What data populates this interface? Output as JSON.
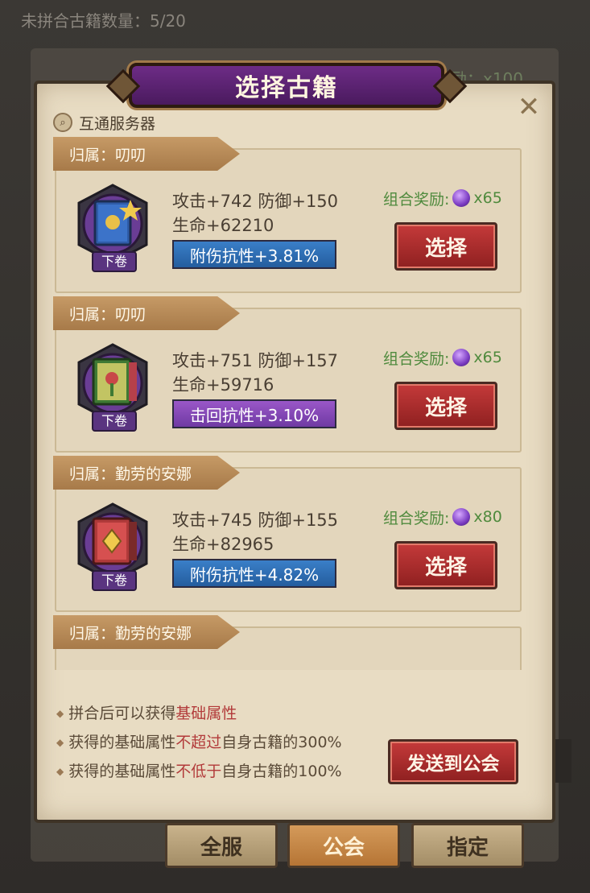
{
  "header": {
    "unassembled_count": "未拼合古籍数量：5/20"
  },
  "background": {
    "reward_text": "合奖励：",
    "reward_amount": "x100"
  },
  "dialog": {
    "title": "选择古籍",
    "server_label": "互通服务器",
    "items": [
      {
        "owner": "归属：叨叨",
        "volume": "下卷",
        "stats_line1": "攻击+742 防御+150",
        "stats_line2": "生命+62210",
        "bonus": "附伤抗性+3.81%",
        "bonus_color": "blue",
        "reward_label": "组合奖励:",
        "reward_amount": "x65",
        "select_label": "选择"
      },
      {
        "owner": "归属：叨叨",
        "volume": "下卷",
        "stats_line1": "攻击+751 防御+157",
        "stats_line2": "生命+59716",
        "bonus": "击回抗性+3.10%",
        "bonus_color": "purple",
        "reward_label": "组合奖励:",
        "reward_amount": "x65",
        "select_label": "选择"
      },
      {
        "owner": "归属：勤劳的安娜",
        "volume": "下卷",
        "stats_line1": "攻击+745 防御+155",
        "stats_line2": "生命+82965",
        "bonus": "附伤抗性+4.82%",
        "bonus_color": "blue",
        "reward_label": "组合奖励:",
        "reward_amount": "x80",
        "select_label": "选择"
      },
      {
        "owner": "归属：勤劳的安娜"
      }
    ],
    "notes": [
      {
        "pre": "拼合后可以获得",
        "hl": "基础属性",
        "post": ""
      },
      {
        "pre": "获得的基础属性",
        "hl": "不超过",
        "post": "自身古籍的300%"
      },
      {
        "pre": "获得的基础属性",
        "hl": "不低于",
        "post": "自身古籍的100%"
      }
    ],
    "send_label": "发送到公会"
  },
  "tabs": [
    "全服",
    "公会",
    "指定"
  ],
  "active_tab": "公会",
  "colors": {
    "select_button": "#b02e2e",
    "title_banner": "#5b2270",
    "reward_green": "#4f8a3d",
    "highlight_red": "#b23a3a"
  }
}
